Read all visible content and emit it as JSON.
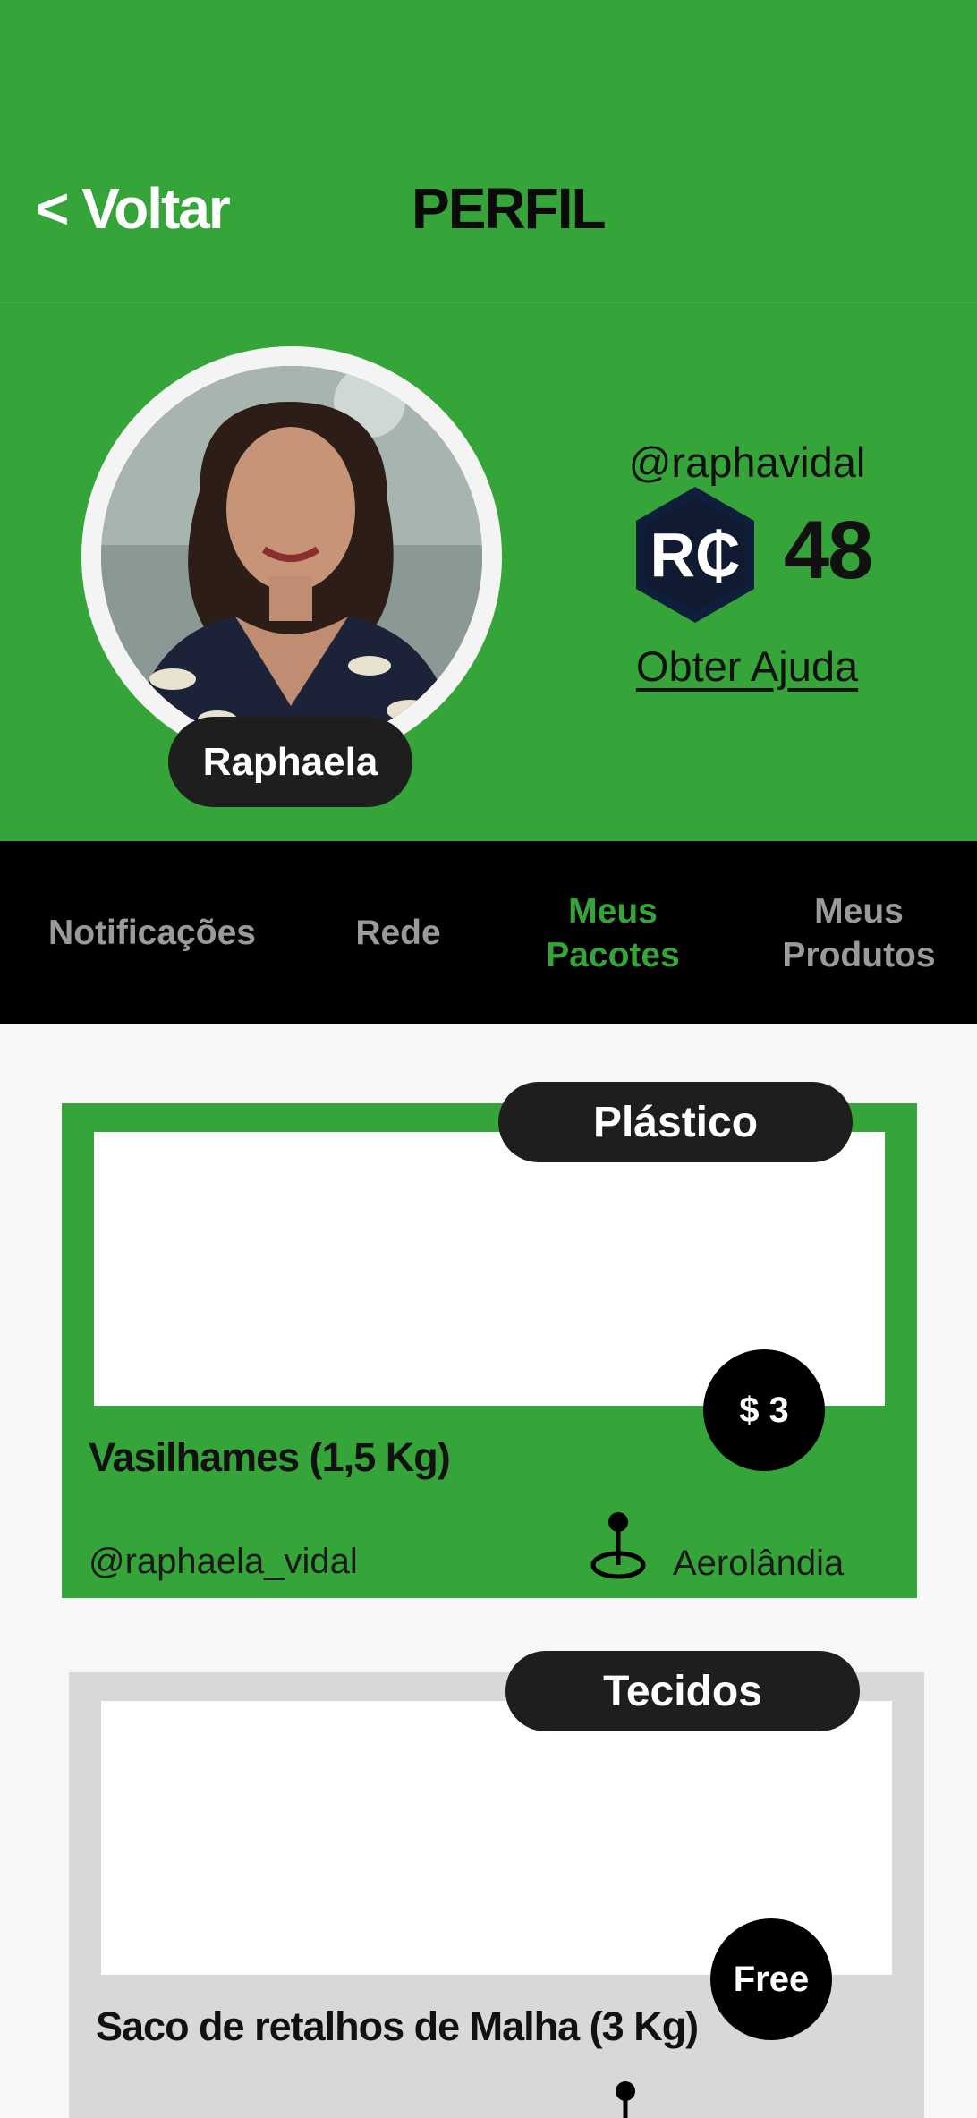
{
  "header": {
    "back_label": "< Voltar",
    "title": "PERFIL"
  },
  "profile": {
    "name": "Raphaela",
    "handle": "@raphavidal",
    "coin_symbol": "R₵",
    "coin_balance": "48",
    "help_link": "Obter Ajuda"
  },
  "tabs": [
    {
      "label": "Notificações",
      "active": false
    },
    {
      "label": "Rede",
      "active": false
    },
    {
      "label": "Meus Pacotes",
      "active": true
    },
    {
      "label": "Meus Produtos",
      "active": false
    }
  ],
  "packages": [
    {
      "category": "Plástico",
      "price": "$ 3",
      "title": "Vasilhames  (1,5 Kg)",
      "owner": "@raphaela_vidal",
      "location": "Aerolândia",
      "card_color": "#36a539"
    },
    {
      "category": "Tecidos",
      "price": "Free",
      "title": "Saco de retalhos de Malha (3 Kg)",
      "card_color": "#d8d8d8"
    }
  ],
  "colors": {
    "accent": "#36a539",
    "dark": "#1e1e1e",
    "tab_inactive": "#9a9a9a"
  },
  "icons": {
    "coin": "rcoin-hexagon-icon",
    "location": "map-pin-icon"
  }
}
